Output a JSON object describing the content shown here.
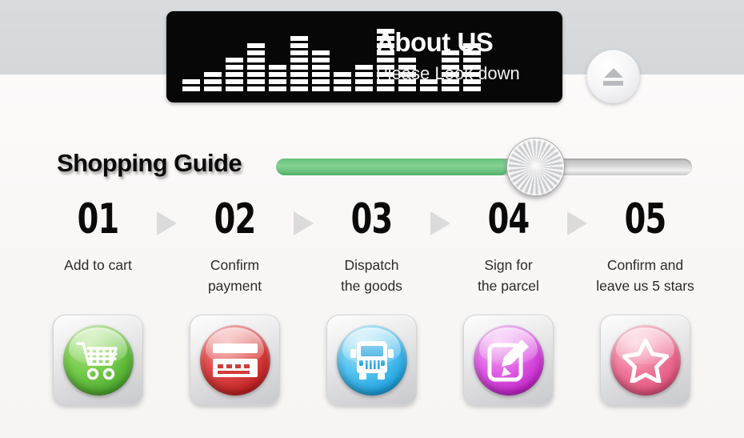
{
  "header": {
    "title": "About US",
    "subtitle": "Please Look down",
    "equalizer": {
      "icon": "equalizer-icon",
      "segments_per_bar": [
        2,
        3,
        5,
        7,
        4,
        8,
        6,
        3,
        4,
        9,
        5,
        2,
        6,
        7
      ]
    },
    "eject_button": {
      "icon": "eject-icon",
      "label": "Eject"
    }
  },
  "guide": {
    "title": "Shopping Guide",
    "progress": {
      "icon": "slider-knob-icon",
      "percent": 56,
      "fill_color": "#6ec482",
      "track_color": "#d8d8d8"
    }
  },
  "steps": [
    {
      "number": "01",
      "label": "Add to cart",
      "icon": "shopping-cart-icon",
      "orb_class": "orb-green",
      "color": "#76cc4b"
    },
    {
      "number": "02",
      "label": "Confirm\npayment",
      "icon": "credit-card-icon",
      "orb_class": "orb-red",
      "color": "#e04a4a"
    },
    {
      "number": "03",
      "label": "Dispatch\nthe goods",
      "icon": "delivery-truck-icon",
      "orb_class": "orb-blue",
      "color": "#58c4f0"
    },
    {
      "number": "04",
      "label": "Sign for\nthe parcel",
      "icon": "sign-document-icon",
      "orb_class": "orb-purple",
      "color": "#e061e6"
    },
    {
      "number": "05",
      "label": "Confirm and\nleave us 5 stars",
      "icon": "star-icon",
      "orb_class": "orb-pink",
      "color": "#f07b9c"
    }
  ],
  "arrow": {
    "icon": "arrow-right-icon"
  },
  "colors": {
    "background_top": "#d6dadc",
    "background_bottom": "#faf8f7",
    "header_bar": "#070707",
    "text_dark": "#0a0a0a",
    "arrow_gray": "#dbdbdb"
  }
}
